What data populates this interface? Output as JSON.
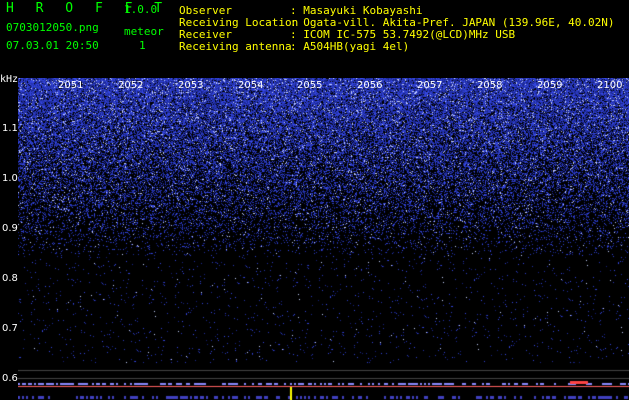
{
  "app": {
    "title": "H R O F F T",
    "version": "1.0.0",
    "filename": "0703012050.png",
    "datetime": "07.03.01 20:50",
    "meteor_label": "meteor",
    "meteor_count": "1"
  },
  "info": [
    {
      "label": "Observer",
      "sep": ":",
      "value": "Masayuki Kobayashi"
    },
    {
      "label": "Receiving Location",
      "sep": ":",
      "value": "Ogata-vill. Akita-Pref. JAPAN (139.96E, 40.02N)"
    },
    {
      "label": "Receiver",
      "sep": ":",
      "value": "ICOM IC-575 53.7492(@LCD)MHz USB"
    },
    {
      "label": "Receiving antenna",
      "sep": ":",
      "value": "A504HB(yagi 4el)"
    }
  ],
  "spectrogram": {
    "y_unit": "kHz",
    "y_ticks": [
      "1.1",
      "1.0",
      "0.9",
      "0.8",
      "0.7",
      "0.6"
    ],
    "x_ticks": [
      "2051",
      "2052",
      "2053",
      "2054",
      "2055",
      "2056",
      "2057",
      "2058",
      "2059",
      "2100"
    ],
    "colors": {
      "noise": "#2d32c8",
      "bright": "#c8d2ff",
      "trace": "#ffff00",
      "baseline": "#ff6060"
    }
  }
}
